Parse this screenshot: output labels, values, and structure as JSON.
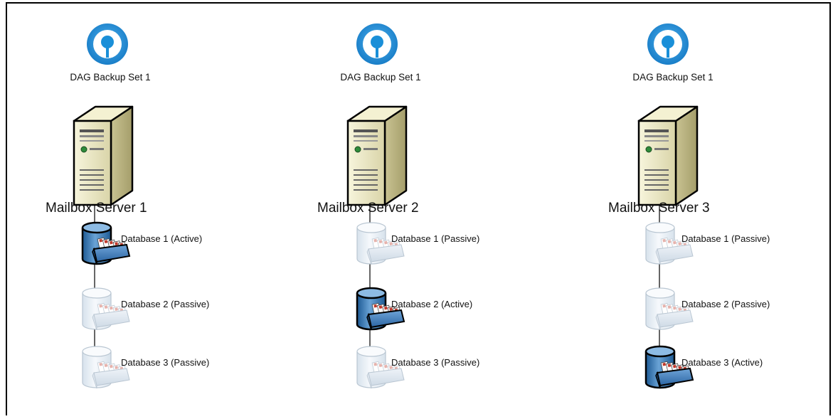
{
  "columns": [
    {
      "backup_set": "DAG Backup Set 1",
      "server": "Mailbox Server 1",
      "databases": [
        {
          "label": "Database 1 (Active)",
          "state": "active"
        },
        {
          "label": "Database 2 (Passive)",
          "state": "passive"
        },
        {
          "label": "Database 3 (Passive)",
          "state": "passive"
        }
      ]
    },
    {
      "backup_set": "DAG Backup Set 1",
      "server": "Mailbox Server 2",
      "databases": [
        {
          "label": "Database 1 (Passive)",
          "state": "passive"
        },
        {
          "label": "Database 2 (Active)",
          "state": "active"
        },
        {
          "label": "Database 3 (Passive)",
          "state": "passive"
        }
      ]
    },
    {
      "backup_set": "DAG Backup Set 1",
      "server": "Mailbox Server 3",
      "databases": [
        {
          "label": "Database 1 (Passive)",
          "state": "passive"
        },
        {
          "label": "Database 2 (Passive)",
          "state": "passive"
        },
        {
          "label": "Database 3 (Active)",
          "state": "active"
        }
      ]
    }
  ],
  "colors": {
    "backup_icon_ring": "#1a8fd8",
    "server_body": "#efecc9",
    "active_db": "#2a6ca8",
    "passive_db": "#e3ecf4"
  },
  "icons": {
    "backup_set": "backup-set-icon",
    "server": "server-tower-icon",
    "database": "mailbox-database-icon"
  }
}
